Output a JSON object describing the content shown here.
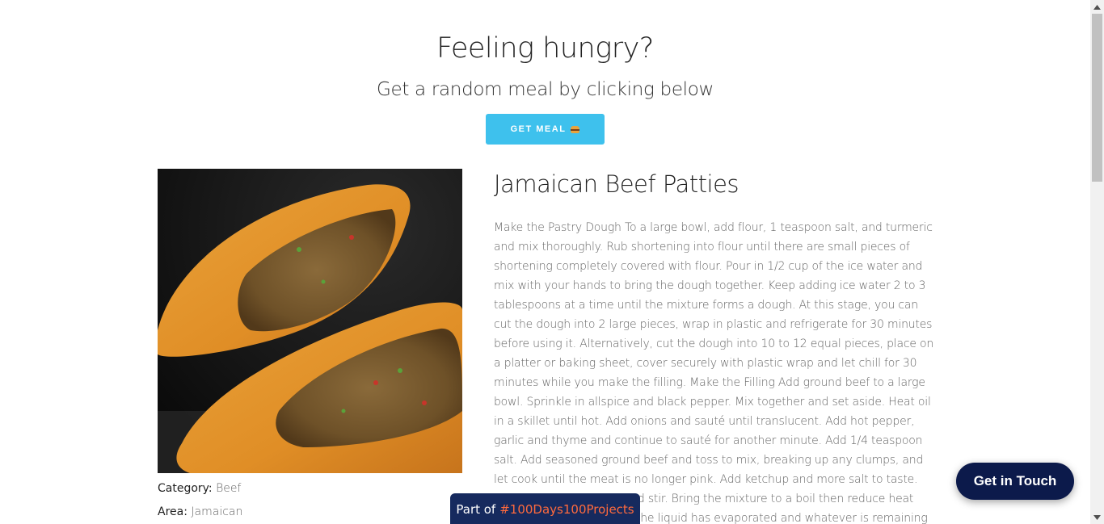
{
  "hero": {
    "title": "Feeling hungry?",
    "subtitle": "Get a random meal by clicking below",
    "button_label": "GET MEAL",
    "button_icon": "burger-icon",
    "accent": "#3ec1ed"
  },
  "meal": {
    "name": "Jamaican Beef Patties",
    "category_label": "Category:",
    "category": "Beef",
    "area_label": "Area:",
    "area": "Jamaican",
    "instructions": "Make the Pastry Dough To a large bowl, add flour, 1 teaspoon salt, and turmeric and mix thoroughly. Rub shortening into flour until there are small pieces of shortening completely covered with flour. Pour in 1/2 cup of the ice water and mix with your hands to bring the dough together. Keep adding ice water 2 to 3 tablespoons at a time until the mixture forms a dough. At this stage, you can cut the dough into 2 large pieces, wrap in plastic and refrigerate for 30 minutes before using it. Alternatively, cut the dough into 10 to 12 equal pieces, place on a platter or baking sheet, cover securely with plastic wrap and let chill for 30 minutes while you make the filling. Make the Filling Add ground beef to a large bowl. Sprinkle in allspice and black pepper. Mix together and set aside. Heat oil in a skillet until hot. Add onions and sauté until translucent. Add hot pepper, garlic and thyme and continue to sauté for another minute. Add 1/4 teaspoon salt. Add seasoned ground beef and toss to mix, breaking up any clumps, and let cook until the meat is no longer pink. Add ketchup and more salt to taste. Pour in 2 cups of water and stir. Bring the mixture to a boil then reduce heat and simmer until most of the liquid has evaporated and whatever is remaining"
  },
  "badge": {
    "prefix": "Part of",
    "tag": "#100Days100Projects",
    "tag_color": "#ff6a3d",
    "background": "#162a5e"
  },
  "contact": {
    "label": "Get in Touch",
    "background": "#0c1a4b"
  }
}
